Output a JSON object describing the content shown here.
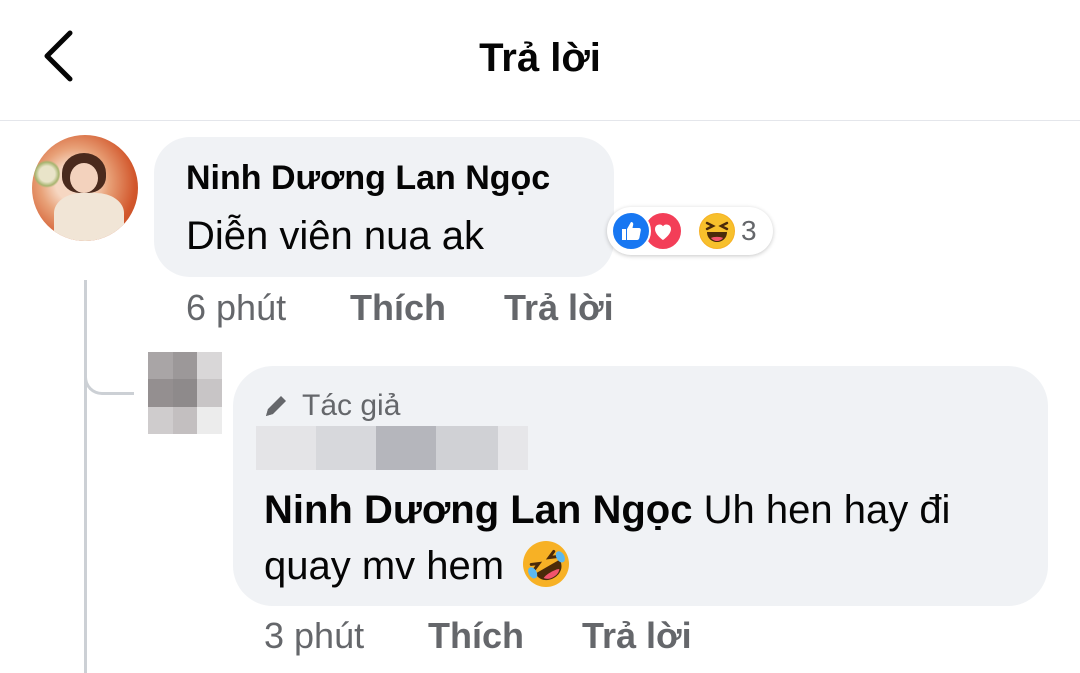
{
  "header": {
    "title": "Trả lời"
  },
  "comment": {
    "author": "Ninh Dương Lan Ngọc",
    "text": "Diễn viên nua ak",
    "reactions": {
      "icons": [
        "like-icon",
        "love-icon",
        "haha-icon"
      ],
      "count": "3"
    },
    "time": "6 phút",
    "like_label": "Thích",
    "reply_label": "Trả lời"
  },
  "reply": {
    "badge": "Tác giả",
    "mention": "Ninh Dương Lan Ngọc",
    "text": "Uh hen hay đi quay mv hem",
    "emoji": "rolling-on-floor-laughing-icon",
    "time": "3 phút",
    "like_label": "Thích",
    "reply_label": "Trả lời"
  },
  "colors": {
    "bubble": "#f0f2f5",
    "secondary_text": "#65676b",
    "like_blue": "#1877f2",
    "love_red": "#f33e58",
    "haha_yellow": "#f7b125"
  }
}
